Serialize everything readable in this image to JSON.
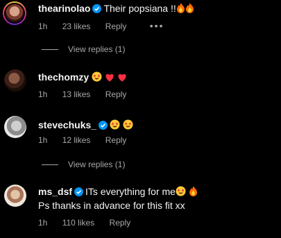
{
  "colors": {
    "background": "#000000",
    "text": "#f5f5f5",
    "muted": "#a8a8a8",
    "verified": "#0095f6",
    "heart": "#ff3040"
  },
  "comments": [
    {
      "username": "thearinolao",
      "verified": true,
      "text": "Their popsiana !!",
      "emojis": [
        "fire",
        "fire"
      ],
      "age": "1h",
      "likes": "23 likes",
      "reply": "Reply",
      "more": "•••"
    },
    {
      "username": "thechomzy",
      "verified": false,
      "text": "",
      "emojis": [
        "star-struck",
        "red-heart",
        "red-heart"
      ],
      "age": "1h",
      "likes": "13 likes",
      "reply": "Reply"
    },
    {
      "username": "stevechuks_",
      "verified": true,
      "text": "",
      "emojis": [
        "star-struck",
        "star-struck"
      ],
      "age": "1h",
      "likes": "12 likes",
      "reply": "Reply"
    },
    {
      "username": "ms_dsf",
      "verified": true,
      "text": "ITs everything for me",
      "text2": "Ps thanks in advance for this fit xx",
      "emojis": [
        "star-struck",
        "fire"
      ],
      "age": "1h",
      "likes": "110 likes",
      "reply": "Reply"
    }
  ],
  "view_replies_1": "View replies (1)",
  "view_replies_2": "View replies (1)"
}
